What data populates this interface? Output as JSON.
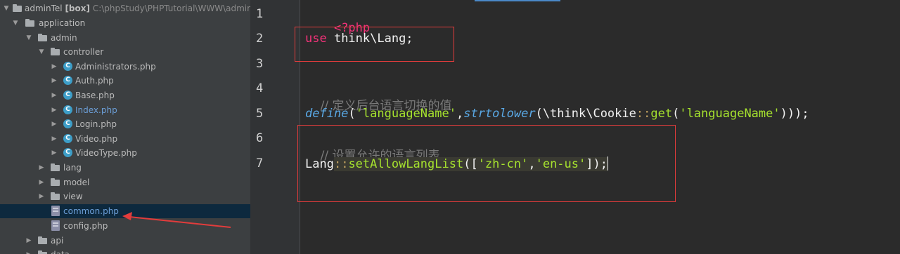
{
  "project_tree": {
    "root_name": "adminTel",
    "root_suffix": "[box]",
    "root_path": "C:\\phpStudy\\PHPTutorial\\WWW\\admin",
    "items": [
      {
        "label": "application"
      },
      {
        "label": "admin"
      },
      {
        "label": "controller"
      },
      {
        "label": "Administrators.php"
      },
      {
        "label": "Auth.php"
      },
      {
        "label": "Base.php"
      },
      {
        "label": "Index.php"
      },
      {
        "label": "Login.php"
      },
      {
        "label": "Video.php"
      },
      {
        "label": "VideoType.php"
      },
      {
        "label": "lang"
      },
      {
        "label": "model"
      },
      {
        "label": "view"
      },
      {
        "label": "common.php"
      },
      {
        "label": "config.php"
      },
      {
        "label": "api"
      },
      {
        "label": "data"
      }
    ]
  },
  "editor": {
    "line_numbers": [
      "1",
      "2",
      "3",
      "4",
      "5",
      "6",
      "7"
    ],
    "line1": {
      "tag": "<?php"
    },
    "line2": {
      "kw": "use",
      "rest": " think\\Lang;"
    },
    "line4": {
      "comment": "// 定义后台语言切换的值"
    },
    "line5": {
      "define": "define",
      "p1": "(",
      "s1": "'languageName'",
      "comma": ",",
      "strtolower": "strtolower",
      "p2": "(\\think\\Cookie",
      "dc": "::",
      "get": "get",
      "p3": "(",
      "s2": "'languageName'",
      "p4": ")));"
    },
    "line6": {
      "comment": "// 设置允许的语言列表"
    },
    "line7": {
      "cls": "Lang",
      "dc": "::",
      "method": "setAllowLangList",
      "p1": "([",
      "s1": "'zh-cn'",
      "comma": ",",
      "s2": "'en-us'",
      "p2": "]);"
    }
  },
  "colors": {
    "keyword_pink": "#f5327a",
    "function_blue": "#5aa9e6",
    "string_green": "#a6e22e",
    "comment_gray": "#7a7a7a",
    "annotation_red": "#e23c3c"
  }
}
